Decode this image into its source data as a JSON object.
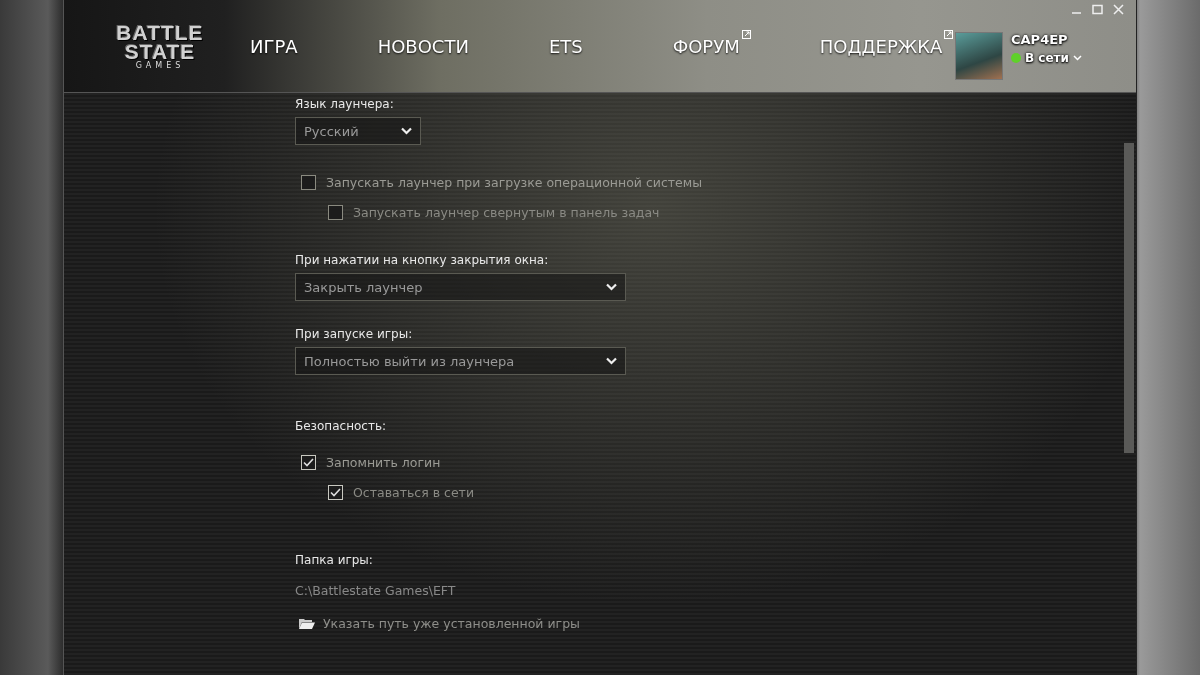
{
  "logo": {
    "line_1": "BATTLE",
    "line_2": "STATE",
    "line_3": "GAMES"
  },
  "nav": [
    {
      "label": "ИГРА",
      "external": false
    },
    {
      "label": "НОВОСТИ",
      "external": false
    },
    {
      "label": "ETS",
      "external": false
    },
    {
      "label": "ФОРУМ",
      "external": true
    },
    {
      "label": "ПОДДЕРЖКА",
      "external": true
    }
  ],
  "user": {
    "name": "САР4ЕР",
    "status": "В сети",
    "color": "#5fd12a"
  },
  "settings": {
    "language": {
      "label": "Язык лаунчера:",
      "value": "Русский"
    },
    "startup": [
      {
        "label": "Запускать лаунчер при загрузке операционной системы",
        "checked": false,
        "children": [
          {
            "label": "Запускать лаунчер свернутым в панель задач",
            "checked": false
          }
        ]
      }
    ],
    "on_close": {
      "label": "При нажатии на кнопку закрытия окна:",
      "value": "Закрыть лаунчер"
    },
    "on_game_start": {
      "label": "При запуске игры:",
      "value": "Полностью выйти из лаунчера"
    },
    "security": {
      "label": "Безопасность:",
      "items": [
        {
          "label": "Запомнить логин",
          "checked": true,
          "children": [
            {
              "label": "Оставаться в сети",
              "checked": true
            }
          ]
        }
      ]
    },
    "game_folder": {
      "label": "Папка игры:",
      "path": "C:\\Battlestate Games\\EFT",
      "link": "Указать путь уже установленной игры"
    }
  }
}
